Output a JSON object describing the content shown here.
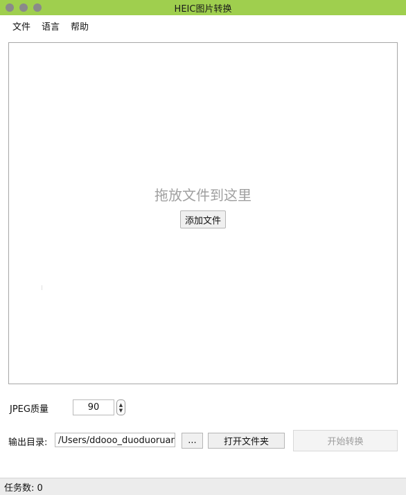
{
  "window": {
    "title": "HEIC图片转换"
  },
  "menu": {
    "items": [
      "文件",
      "语言",
      "帮助"
    ]
  },
  "dropzone": {
    "hint": "拖放文件到这里",
    "add_button": "添加文件"
  },
  "settings": {
    "quality_label": "JPEG质量",
    "quality_value": "90",
    "output_label": "输出目录:",
    "output_path": "/Users/ddooo_duoduoruanjia",
    "browse_label": "...",
    "open_folder_label": "打开文件夹",
    "start_label": "开始转换"
  },
  "status": {
    "text": "任务数: 0"
  },
  "icons": {
    "traffic_lights": [
      "window-close-icon",
      "window-minimize-icon",
      "window-zoom-icon"
    ],
    "stepper": [
      "chevron-up-icon",
      "chevron-down-icon"
    ]
  },
  "colors": {
    "titlebar": "#9fcf4e"
  }
}
